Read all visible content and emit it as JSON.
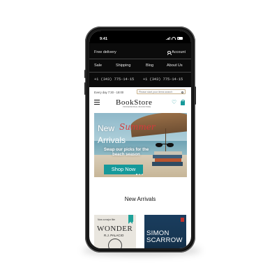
{
  "status": {
    "time": "9:41"
  },
  "topbar": {
    "free_delivery": "Free delivery",
    "account": "Account",
    "nav": [
      "Sale",
      "Shipping",
      "Blog",
      "About Us"
    ],
    "phones": [
      "+1 (343) 775-14-15",
      "+1 (343) 775-14-15"
    ]
  },
  "info": {
    "hours": "Every day 7:30 - 18:00",
    "search_placeholder": "Please start your items search"
  },
  "logo": {
    "title": "BookStore",
    "tagline": "PROFESSIONAL BOOKSTORE"
  },
  "hero": {
    "word_new": "New",
    "word_summer": "Summer",
    "word_arrivals": "Arrivals",
    "subtitle_line1": "Swap our picks for the",
    "subtitle_line2": "beach season",
    "button": "Shop Now"
  },
  "section": {
    "title": "New Arrivals"
  },
  "products": [
    {
      "tag_line1": "Now a major film",
      "title": "WONDER",
      "author": "R.J. PALACIO"
    },
    {
      "title_line1": "SIMON",
      "title_line2": "SCARROW"
    }
  ],
  "colors": {
    "accent": "#16999a",
    "summer_red": "#d63a3a",
    "header_bg": "#0b0b0b"
  }
}
